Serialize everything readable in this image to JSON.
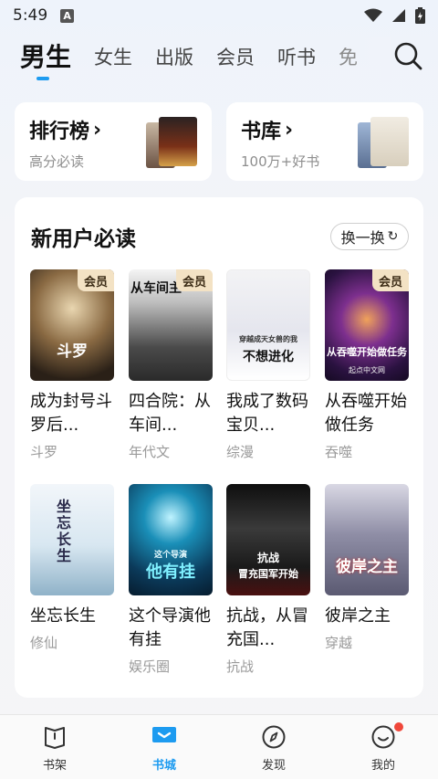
{
  "status": {
    "time": "5:49",
    "a_icon": "A"
  },
  "tabs": [
    {
      "label": "男生",
      "active": true
    },
    {
      "label": "女生"
    },
    {
      "label": "出版"
    },
    {
      "label": "会员"
    },
    {
      "label": "听书"
    },
    {
      "label": "免"
    }
  ],
  "rank_cards": [
    {
      "title": "排行榜",
      "chevron": "›",
      "subtitle": "高分必读"
    },
    {
      "title": "书库",
      "chevron": "›",
      "subtitle": "100万+好书"
    }
  ],
  "section": {
    "title": "新用户必读",
    "refresh_label": "换一换",
    "refresh_icon": "↻"
  },
  "vip_label": "会员",
  "books": [
    {
      "title": "成为封号斗罗后...",
      "tag": "斗罗",
      "vip": true
    },
    {
      "title": "四合院：从车间...",
      "tag": "年代文",
      "vip": true,
      "cover_text": "从车间主"
    },
    {
      "title": "我成了数码宝贝...",
      "tag": "综漫",
      "vip": false,
      "cover_text": "不想进化",
      "cover_sub": "穿越成天女兽的我"
    },
    {
      "title": "从吞噬开始做任务",
      "tag": "吞噬",
      "vip": true,
      "cover_text": "从吞噬开始做任务",
      "cover_sub": "起点中文网"
    },
    {
      "title": "坐忘长生",
      "tag": "修仙",
      "vip": false,
      "cover_text": "坐忘长生"
    },
    {
      "title": "这个导演他有挂",
      "tag": "娱乐圈",
      "vip": false,
      "cover_text": "他有挂",
      "cover_sub": "这个导演"
    },
    {
      "title": "抗战，从冒充国...",
      "tag": "抗战",
      "vip": false,
      "cover_text": "冒充国军开始",
      "cover_sub": "抗战"
    },
    {
      "title": "彼岸之主",
      "tag": "穿越",
      "vip": false,
      "cover_text": "彼岸之主"
    }
  ],
  "bottom_nav": [
    {
      "label": "书架",
      "icon": "bookshelf-icon"
    },
    {
      "label": "书城",
      "icon": "bookstore-icon",
      "active": true
    },
    {
      "label": "发现",
      "icon": "compass-icon"
    },
    {
      "label": "我的",
      "icon": "profile-icon",
      "badge": true
    }
  ],
  "colors": {
    "accent": "#1d9bf0",
    "vip_bg": "#f3e2c4",
    "badge": "#f0473a"
  }
}
